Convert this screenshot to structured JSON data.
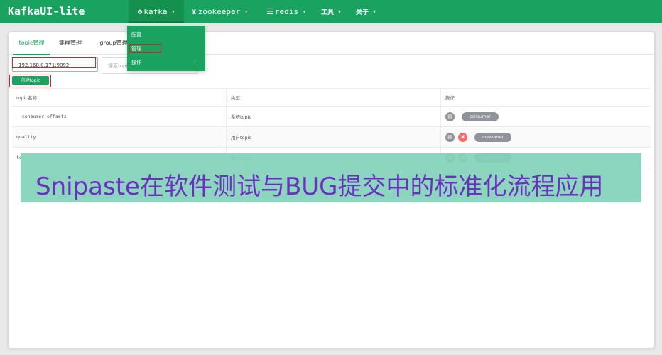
{
  "app": {
    "title": "KafkaUI-lite"
  },
  "nav": [
    {
      "label": "kafka"
    },
    {
      "label": "zookeeper"
    },
    {
      "label": "redis"
    },
    {
      "label": "工具"
    },
    {
      "label": "关于"
    }
  ],
  "kafka_menu": {
    "items": [
      {
        "label": "配置"
      },
      {
        "label": "管理"
      },
      {
        "label": "操作"
      }
    ]
  },
  "tabs": [
    {
      "label": "topic管理"
    },
    {
      "label": "集群管理"
    },
    {
      "label": "group管理"
    }
  ],
  "cluster_input": {
    "value": "192.168.0.171:9092"
  },
  "search": {
    "placeholder": "搜索topic"
  },
  "create_button": {
    "label": "创建topic"
  },
  "table": {
    "headers": [
      "topic名称",
      "类型",
      "操作"
    ],
    "rows": [
      {
        "name": "__consumer_offsets",
        "type": "系统topic",
        "action": "consumer"
      },
      {
        "name": "quality",
        "type": "用户topic",
        "action": "consumer"
      },
      {
        "name": "test",
        "type": "用户topic",
        "action": "consumer"
      }
    ]
  },
  "overlay": {
    "text": "Snipaste在软件测试与BUG提交中的标准化流程应用"
  },
  "colors": {
    "primary": "#1aa260",
    "danger": "#f56c6c",
    "neutral": "#909399",
    "highlight": "#e02020"
  }
}
